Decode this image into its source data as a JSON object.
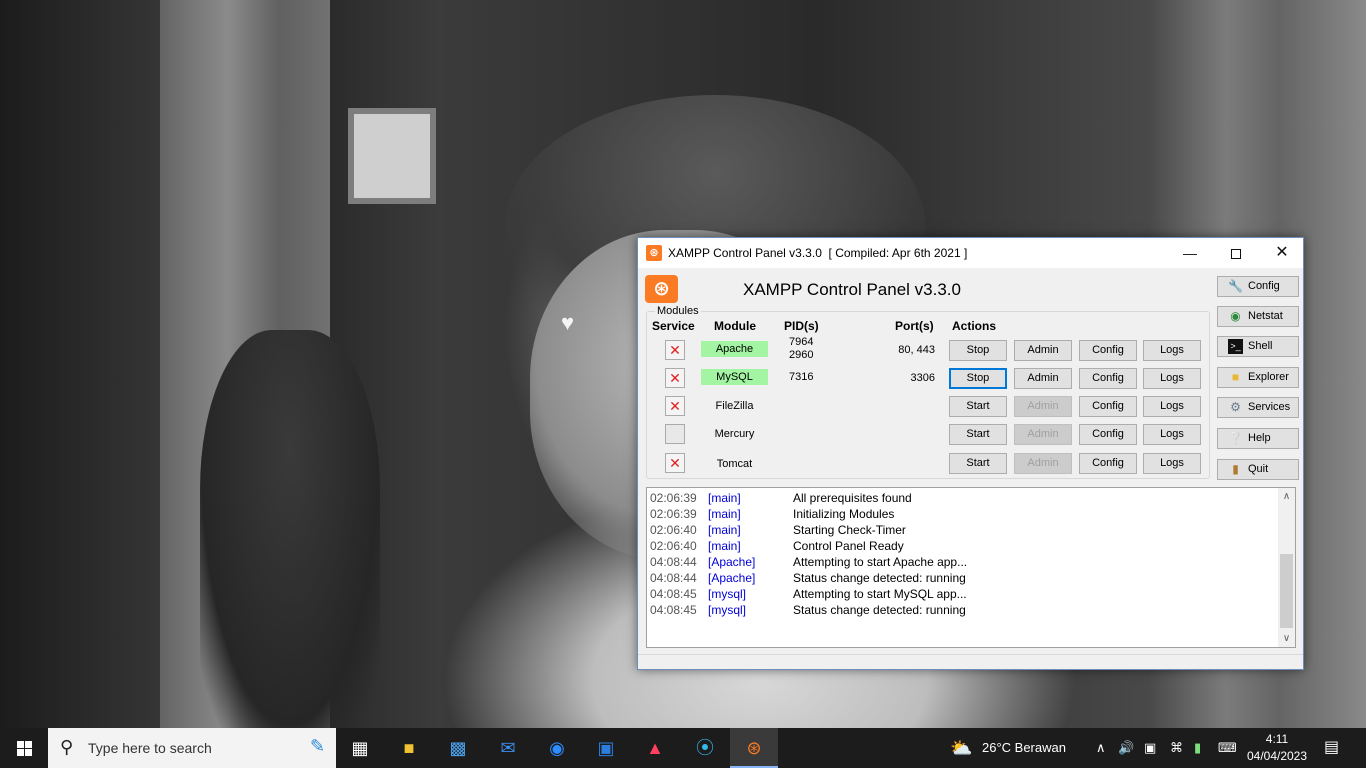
{
  "window": {
    "title": "XAMPP Control Panel v3.3.0  [ Compiled: Apr 6th 2021 ]",
    "minimize": "—",
    "close": "✕",
    "heading": "XAMPP Control Panel v3.3.0",
    "logo_glyph": "⦿"
  },
  "modules_label": "Modules",
  "headers": {
    "service": "Service",
    "module": "Module",
    "pids": "PID(s)",
    "ports": "Port(s)",
    "actions": "Actions"
  },
  "modules": [
    {
      "name": "Apache",
      "pid": "7964",
      "pid2": "2960",
      "ports": "80, 443",
      "action": "Stop",
      "admin": "Admin",
      "config": "Config",
      "logs": "Logs"
    },
    {
      "name": "MySQL",
      "pid": "7316",
      "pid2": "",
      "ports": "3306",
      "action": "Stop",
      "admin": "Admin",
      "config": "Config",
      "logs": "Logs"
    },
    {
      "name": "FileZilla",
      "pid": "",
      "pid2": "",
      "ports": "",
      "action": "Start",
      "admin": "Admin",
      "config": "Config",
      "logs": "Logs"
    },
    {
      "name": "Mercury",
      "pid": "",
      "pid2": "",
      "ports": "",
      "action": "Start",
      "admin": "Admin",
      "config": "Config",
      "logs": "Logs"
    },
    {
      "name": "Tomcat",
      "pid": "",
      "pid2": "",
      "ports": "",
      "action": "Start",
      "admin": "Admin",
      "config": "Config",
      "logs": "Logs"
    }
  ],
  "side_buttons": {
    "config": "Config",
    "netstat": "Netstat",
    "shell": "Shell",
    "explorer": "Explorer",
    "services": "Services",
    "help": "Help",
    "quit": "Quit"
  },
  "log": [
    {
      "time": "02:06:39",
      "module": "[main]",
      "msg": "All prerequisites found"
    },
    {
      "time": "02:06:39",
      "module": "[main]",
      "msg": "Initializing Modules"
    },
    {
      "time": "02:06:40",
      "module": "[main]",
      "msg": "Starting Check-Timer"
    },
    {
      "time": "02:06:40",
      "module": "[main]",
      "msg": "Control Panel Ready"
    },
    {
      "time": "04:08:44",
      "module": "[Apache]",
      "msg": "Attempting to start Apache app..."
    },
    {
      "time": "04:08:44",
      "module": "[Apache]",
      "msg": "Status change detected: running"
    },
    {
      "time": "04:08:45",
      "module": "[mysql]",
      "msg": "Attempting to start MySQL app..."
    },
    {
      "time": "04:08:45",
      "module": "[mysql]",
      "msg": "Status change detected: running"
    }
  ],
  "taskbar": {
    "search_placeholder": "Type here to search",
    "weather": "26°C  Berawan",
    "time": "4:11",
    "date": "04/04/2023"
  },
  "colors": {
    "running": "#a3f5a3",
    "xampp_orange": "#fb7a24",
    "log_module": "#0000d8"
  }
}
